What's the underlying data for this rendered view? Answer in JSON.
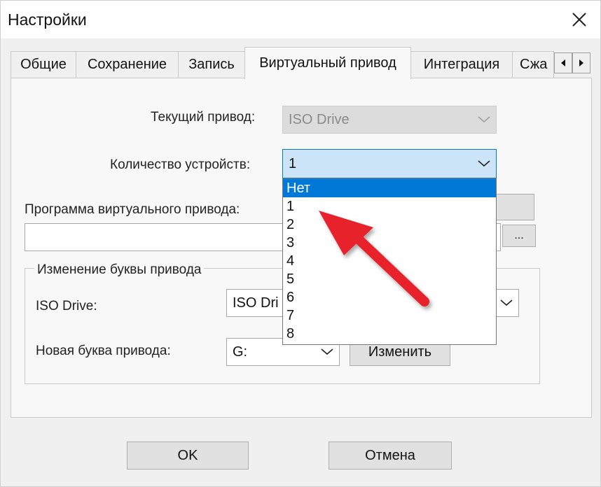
{
  "window": {
    "title": "Настройки",
    "close_label": "✕"
  },
  "tabs": [
    {
      "label": "Общие",
      "active": false
    },
    {
      "label": "Сохранение",
      "active": false
    },
    {
      "label": "Запись",
      "active": false
    },
    {
      "label": "Виртуальный привод",
      "active": true
    },
    {
      "label": "Интеграция",
      "active": false
    },
    {
      "label": "Сжа",
      "active": false
    }
  ],
  "virtual_drive": {
    "current_drive_label": "Текущий привод:",
    "current_drive_value": "ISO Drive",
    "device_count_label": "Количество устройств:",
    "device_count_value": "1",
    "program_label": "Программа виртуального привода:",
    "browse_label": "..."
  },
  "dropdown": {
    "options": [
      "Нет",
      "1",
      "2",
      "3",
      "4",
      "5",
      "6",
      "7",
      "8"
    ],
    "highlighted": "Нет"
  },
  "drive_letter_group": {
    "title": "Изменение буквы привода",
    "drive_label": "ISO Drive:",
    "drive_value": "ISO Dri",
    "new_letter_label": "Новая буква привода:",
    "new_letter_value": "G:",
    "change_button": "Изменить"
  },
  "footer": {
    "ok_label": "OK",
    "cancel_label": "Отмена"
  },
  "colors": {
    "accent": "#0078d7",
    "arrow": "#e8232a"
  }
}
